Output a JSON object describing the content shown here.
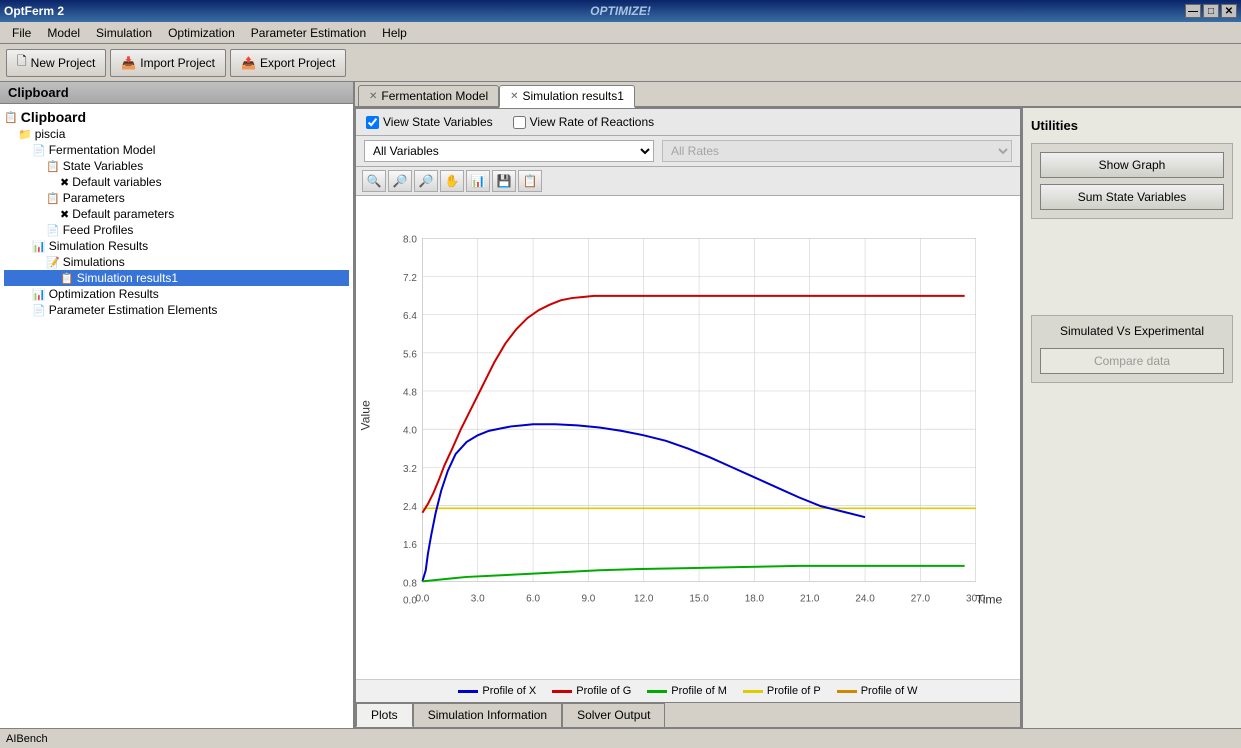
{
  "app": {
    "title": "OptFerm 2",
    "title_center": "OPTIMIZE!"
  },
  "titlebar": {
    "minimize": "—",
    "maximize": "□",
    "close": "✕"
  },
  "menu": {
    "items": [
      "File",
      "Model",
      "Simulation",
      "Optimization",
      "Parameter Estimation",
      "Help"
    ]
  },
  "toolbar": {
    "new_project": "New Project",
    "import_project": "Import Project",
    "export_project": "Export Project"
  },
  "left_panel": {
    "header": "Clipboard",
    "tree": [
      {
        "label": "Clipboard",
        "level": 0,
        "icon": "📋",
        "bold": true
      },
      {
        "label": "piscia",
        "level": 1,
        "icon": "📁"
      },
      {
        "label": "Fermentation Model",
        "level": 2,
        "icon": "📄"
      },
      {
        "label": "State Variables",
        "level": 3,
        "icon": "📋"
      },
      {
        "label": "Default variables",
        "level": 4,
        "icon": "✖"
      },
      {
        "label": "Parameters",
        "level": 3,
        "icon": "📋"
      },
      {
        "label": "Default parameters",
        "level": 4,
        "icon": "✖"
      },
      {
        "label": "Feed Profiles",
        "level": 3,
        "icon": "📄"
      },
      {
        "label": "Simulation Results",
        "level": 2,
        "icon": "📊"
      },
      {
        "label": "Simulations",
        "level": 3,
        "icon": "📝"
      },
      {
        "label": "Simulation results1",
        "level": 4,
        "icon": "📋",
        "selected": true
      },
      {
        "label": "Optimization Results",
        "level": 2,
        "icon": "📊"
      },
      {
        "label": "Parameter Estimation Elements",
        "level": 2,
        "icon": "📄"
      }
    ]
  },
  "tabs": {
    "items": [
      {
        "label": "Fermentation Model",
        "active": false,
        "closable": true
      },
      {
        "label": "Simulation results1",
        "active": true,
        "closable": true
      }
    ]
  },
  "controls": {
    "view_state_variables_label": "View State Variables",
    "view_state_variables_checked": true,
    "view_rate_label": "View Rate of Reactions",
    "view_rate_checked": false
  },
  "dropdowns": {
    "variables": {
      "value": "All Variables",
      "options": [
        "All Variables",
        "X",
        "G",
        "M",
        "P",
        "W"
      ]
    },
    "rates": {
      "value": "All Rates",
      "options": [
        "All Rates"
      ],
      "disabled": true
    }
  },
  "graph": {
    "x_label": "Time",
    "y_label": "Value",
    "y_max": 8.0,
    "y_ticks": [
      "8.0",
      "7.2",
      "6.4",
      "5.6",
      "4.8",
      "4.0",
      "3.2",
      "2.4",
      "1.6",
      "0.8",
      "0.0"
    ],
    "x_ticks": [
      "0.0",
      "3.0",
      "6.0",
      "9.0",
      "12.0",
      "15.0",
      "18.0",
      "21.0",
      "24.0",
      "27.0",
      "30.0"
    ]
  },
  "legend": {
    "items": [
      {
        "label": "Profile of X",
        "color": "#0000cc"
      },
      {
        "label": "Profile of G",
        "color": "#cc0000"
      },
      {
        "label": "Profile of M",
        "color": "#00aa00"
      },
      {
        "label": "Profile of P",
        "color": "#ddcc00"
      },
      {
        "label": "Profile of W",
        "color": "#cc8800"
      }
    ]
  },
  "bottom_tabs": {
    "items": [
      {
        "label": "Plots",
        "active": true
      },
      {
        "label": "Simulation Information",
        "active": false
      },
      {
        "label": "Solver Output",
        "active": false
      }
    ]
  },
  "utilities": {
    "title": "Utilities",
    "show_graph_label": "Show Graph",
    "sum_state_variables_label": "Sum State Variables",
    "simulated_vs_experimental_label": "Simulated Vs Experimental",
    "compare_data_label": "Compare data"
  },
  "status_bar": {
    "text": "AIBench"
  }
}
